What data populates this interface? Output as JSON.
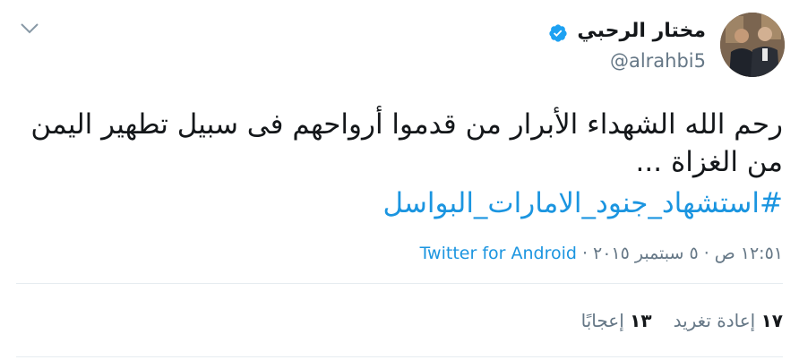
{
  "author": {
    "display_name": "مختار الرحبي",
    "handle": "@alrahbi5",
    "verified": true
  },
  "tweet": {
    "text": "رحم الله الشهداء الأبرار من قدموا أرواحهم فى سبيل تطهير اليمن من الغزاة ...",
    "hashtag": "#استشهاد_جنود_الامارات_البواسل"
  },
  "meta": {
    "time": "١٢:٥١ ص",
    "date": "٥ سبتمبر ٢٠١٥",
    "source": "Twitter for Android"
  },
  "stats": {
    "retweets_count": "١٧",
    "retweets_label": "إعادة تغريد",
    "likes_count": "١٣",
    "likes_label": "إعجابًا"
  },
  "icons": {
    "verified": "verified-badge-icon",
    "more": "chevron-down-icon"
  },
  "colors": {
    "link": "#1b95e0",
    "text": "#14171a",
    "muted": "#657786",
    "divider": "#e6ecf0"
  }
}
